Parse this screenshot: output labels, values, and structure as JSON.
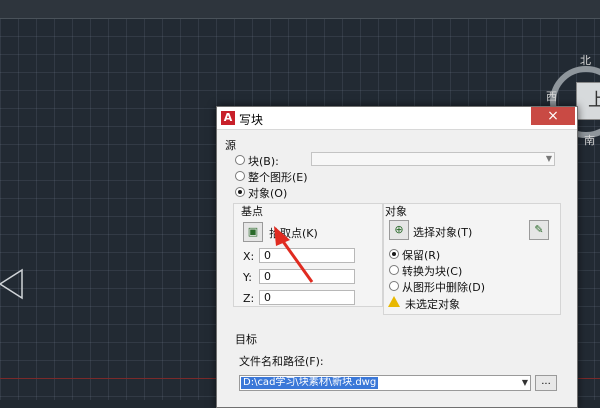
{
  "viewcube": {
    "north": "北",
    "west": "西",
    "south": "南",
    "face": "上"
  },
  "dialog": {
    "title": "写块",
    "close": "×",
    "source": {
      "label": "源",
      "options": [
        "块(B):",
        "整个图形(E)",
        "对象(O)"
      ],
      "selected": "对象(O)",
      "block_value": ""
    },
    "base_point": {
      "label": "基点",
      "pick_label": "拾取点(K)",
      "x_label": "X:",
      "x_value": "0",
      "y_label": "Y:",
      "y_value": "0",
      "z_label": "Z:",
      "z_value": "0"
    },
    "objects": {
      "label": "对象",
      "select_label": "选择对象(T)",
      "options": [
        "保留(R)",
        "转换为块(C)",
        "从图形中删除(D)"
      ],
      "selected": "保留(R)",
      "status": "未选定对象"
    },
    "target": {
      "label": "目标",
      "path_label": "文件名和路径(F):",
      "path_value": "D:\\cad学习\\块素材\\新块.dwg",
      "browse": "..."
    }
  },
  "colors": {
    "accent": "#c8202a",
    "selection": "#3b78d8",
    "annotation_arrow": "#e02b20"
  }
}
